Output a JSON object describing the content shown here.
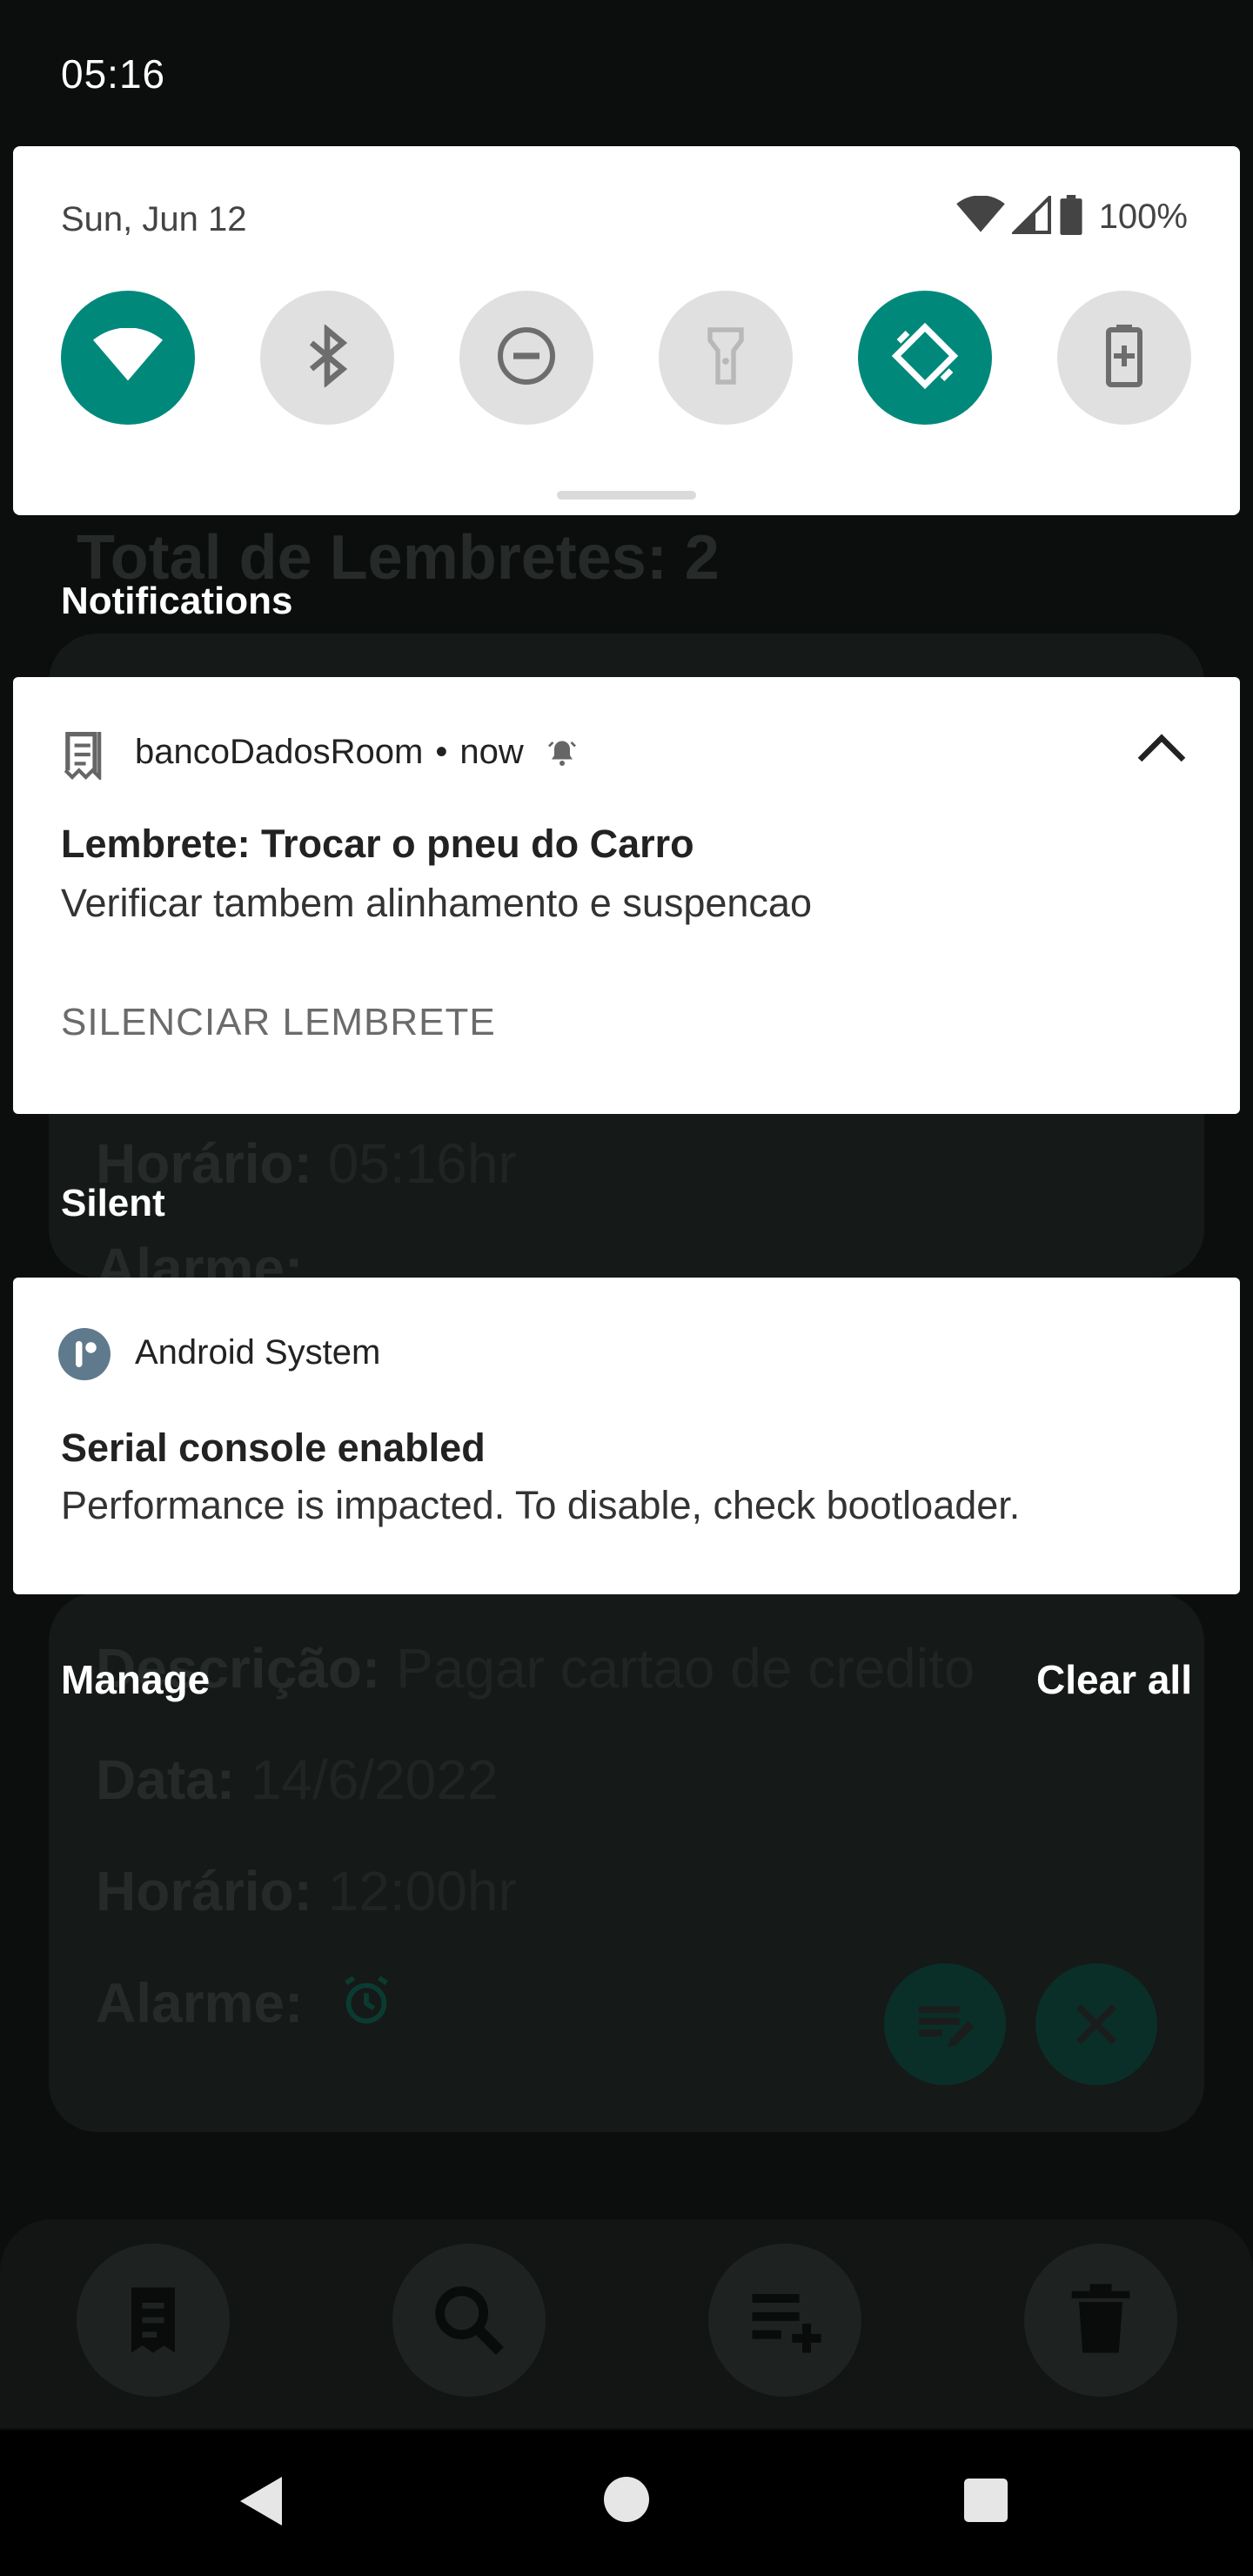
{
  "status_bar": {
    "time": "05:16"
  },
  "quick_settings": {
    "date": "Sun, Jun 12",
    "battery": "100%",
    "tiles": [
      {
        "name": "wifi",
        "icon": "wifi-icon",
        "active": true
      },
      {
        "name": "bluetooth",
        "icon": "bluetooth-icon",
        "active": false
      },
      {
        "name": "do-not-disturb",
        "icon": "do-not-disturb-icon",
        "active": false
      },
      {
        "name": "flashlight",
        "icon": "flashlight-icon",
        "active": false
      },
      {
        "name": "auto-rotate",
        "icon": "auto-rotate-icon",
        "active": true
      },
      {
        "name": "battery-saver",
        "icon": "battery-saver-icon",
        "active": false
      }
    ],
    "colors": {
      "active": "#00897b",
      "inactive": "#e0e0e0"
    }
  },
  "sections": {
    "notifications": "Notifications",
    "silent": "Silent"
  },
  "notifications": [
    {
      "app": "bancoDadosRoom",
      "time": "now",
      "separator": "•",
      "title": "Lembrete: Trocar o pneu do Carro",
      "text": "Verificar tambem alinhamento e suspencao",
      "action": "SILENCIAR LEMBRETE"
    },
    {
      "app": "Android System",
      "title": "Serial console enabled",
      "text": "Performance is impacted. To disable, check bootloader."
    }
  ],
  "footer": {
    "manage": "Manage",
    "clear_all": "Clear all"
  },
  "background_app": {
    "total": "Total de Lembretes: 2",
    "card1": {
      "time_label": "Horário:",
      "time_value": "05:16hr",
      "alarm_label": "Alarme:"
    },
    "card2": {
      "desc_label": "Descrição:",
      "desc_value": "Pagar cartao de credito",
      "date_label": "Data:",
      "date_value": "14/6/2022",
      "time_label": "Horário:",
      "time_value": "12:00hr",
      "alarm_label": "Alarme:"
    }
  }
}
